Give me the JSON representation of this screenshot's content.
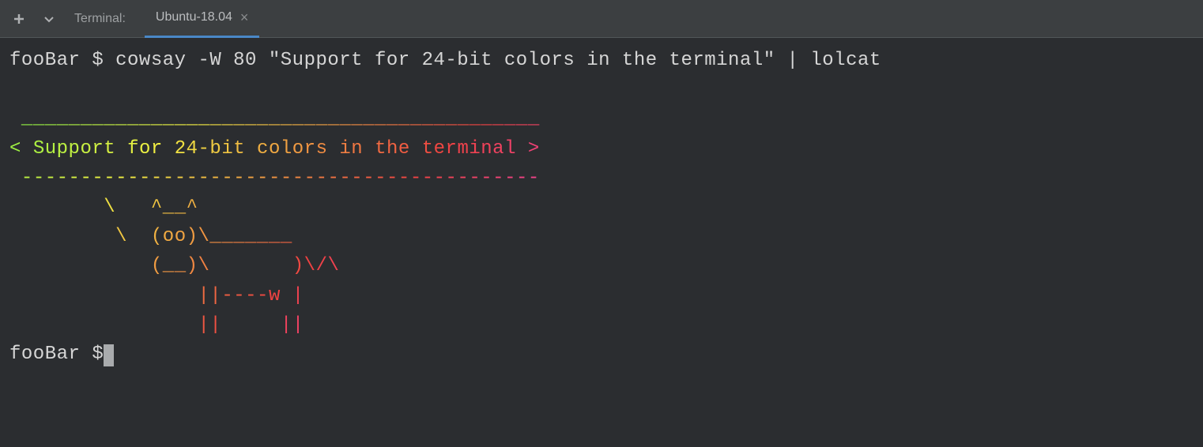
{
  "header": {
    "label": "Terminal:",
    "tab": {
      "label": "Ubuntu-18.04",
      "close": "×"
    }
  },
  "terminal": {
    "prompt1_user": "fooBar $ ",
    "command": "cowsay -W 80 \"Support for 24-bit colors in the terminal\" | lolcat",
    "prompt2_user": "fooBar $"
  },
  "cowsay": {
    "top": " ____________________________________________ ",
    "msg": "< Support for 24-bit colors in the terminal >",
    "bot": " -------------------------------------------- ",
    "l1": "        \\   ^__^",
    "l2": "         \\  (oo)\\_______",
    "l3": "            (__)\\       )\\/\\",
    "l4": "                ||----w |",
    "l5": "                ||     ||"
  }
}
